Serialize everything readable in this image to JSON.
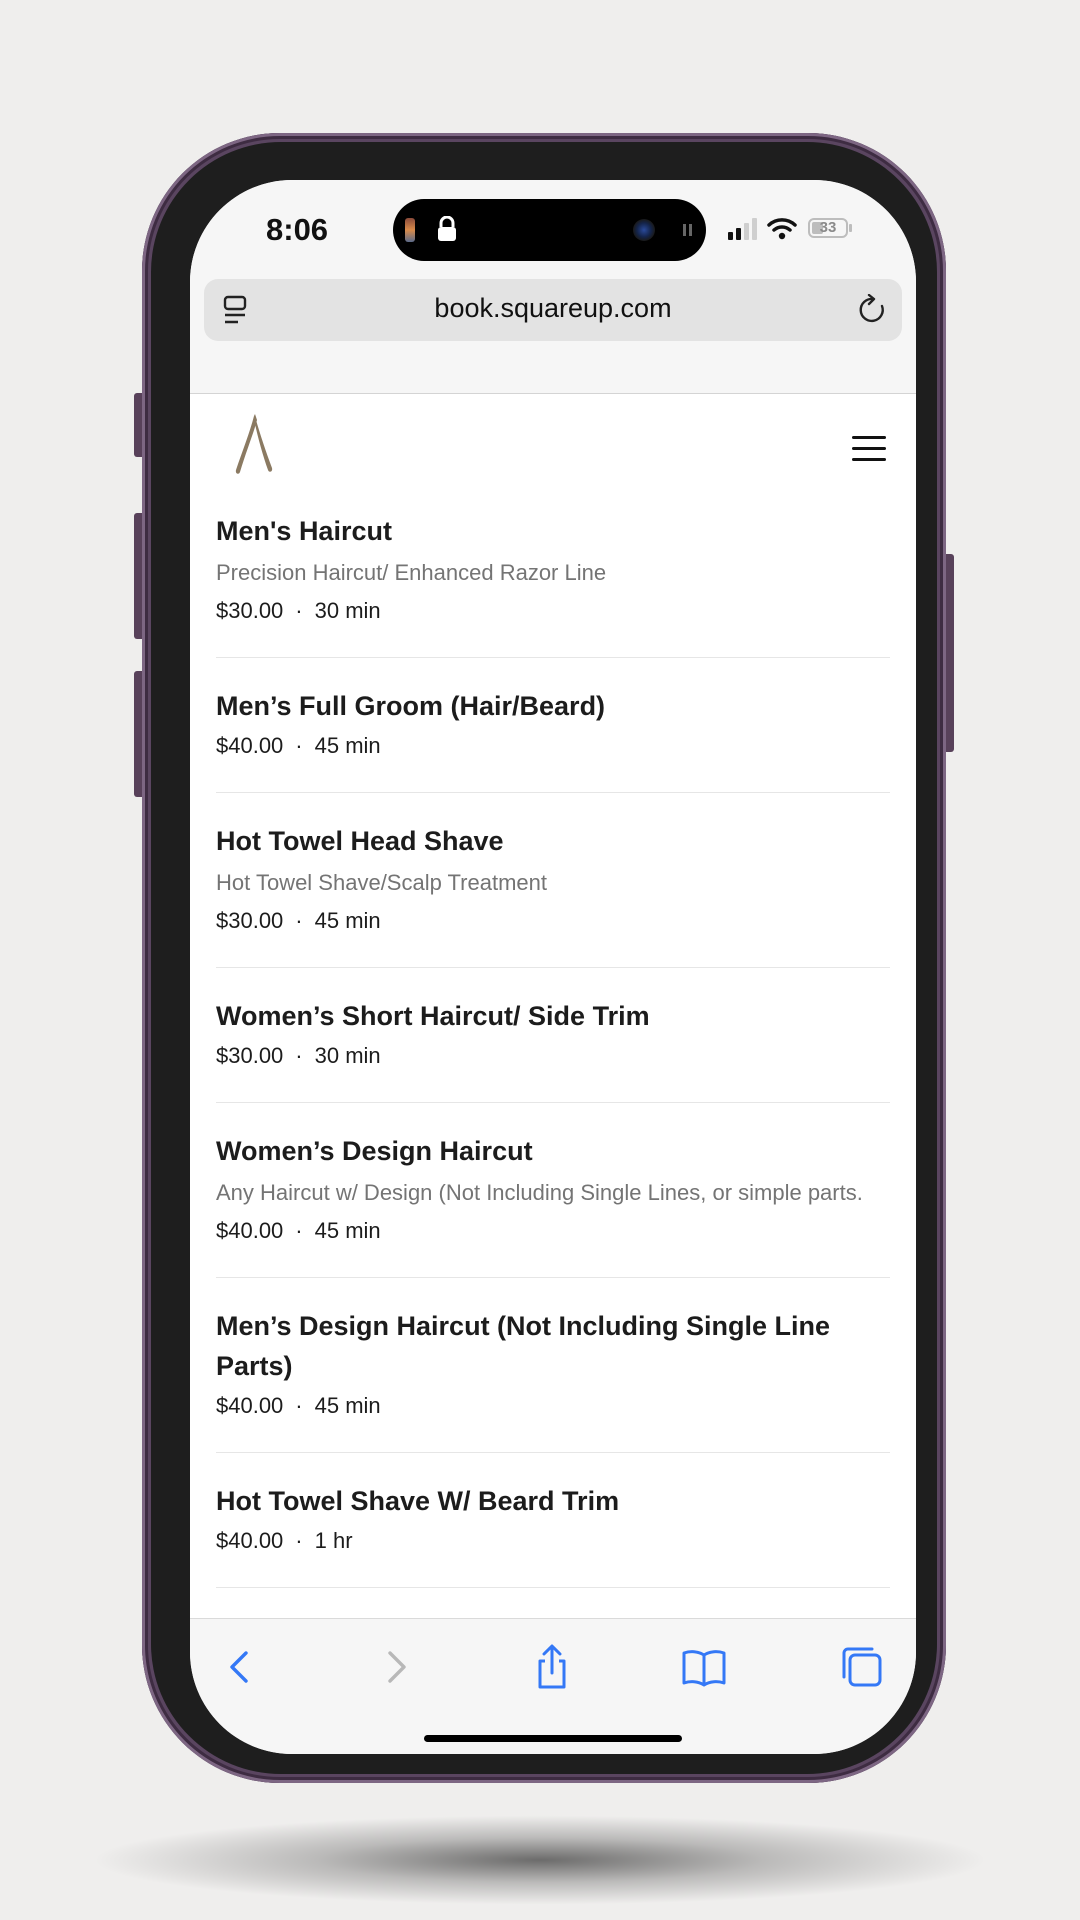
{
  "status_bar": {
    "time": "8:06",
    "battery_level": "33"
  },
  "browser": {
    "url": "book.squareup.com"
  },
  "services": [
    {
      "name": "Men's Haircut",
      "description": "Precision Haircut/ Enhanced Razor Line",
      "price": "$30.00",
      "duration": "30 min"
    },
    {
      "name": "Men’s Full Groom (Hair/Beard)",
      "description": "",
      "price": "$40.00",
      "duration": "45 min"
    },
    {
      "name": "Hot Towel Head Shave",
      "description": "Hot Towel Shave/Scalp Treatment",
      "price": "$30.00",
      "duration": "45 min"
    },
    {
      "name": "Women’s Short Haircut/ Side Trim",
      "description": "",
      "price": "$30.00",
      "duration": "30 min"
    },
    {
      "name": "Women’s Design Haircut",
      "description": "Any Haircut w/ Design (Not Including Single Lines, or simple parts.",
      "price": "$40.00",
      "duration": "45 min"
    },
    {
      "name": "Men’s Design Haircut (Not Including Single Line Parts)",
      "description": "",
      "price": "$40.00",
      "duration": "45 min"
    },
    {
      "name": "Hot Towel Shave W/ Beard Trim",
      "description": "",
      "price": "$40.00",
      "duration": "1 hr"
    }
  ],
  "meta_separator": "·",
  "colors": {
    "accent_blue": "#3478f6",
    "logo_brown": "#8b7a62",
    "phone_frame": "#5a4560"
  },
  "icons": {
    "reader": "reader-mode-icon",
    "reload": "reload-icon",
    "menu": "hamburger-menu-icon",
    "back": "back-chevron-icon",
    "forward": "forward-chevron-icon",
    "share": "share-icon",
    "bookmarks": "bookmarks-icon",
    "tabs": "tabs-icon"
  }
}
